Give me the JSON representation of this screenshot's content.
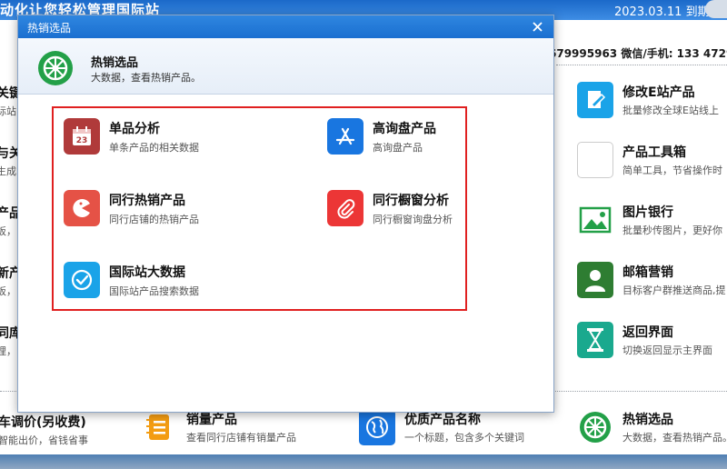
{
  "background": {
    "slogan": "动化让您轻松管理国际站",
    "expiry": "2023.03.11 到期",
    "contact": "679995963  微信/手机: 133 4729",
    "left_items": [
      {
        "title": "关键",
        "desc": "际站"
      },
      {
        "title": "与关",
        "desc": "生成"
      },
      {
        "title": "产品",
        "desc": "板，"
      },
      {
        "title": "新产",
        "desc": "板，"
      },
      {
        "title": "同库",
        "desc": "理，"
      }
    ],
    "right_tools": [
      {
        "title": "修改E站产品",
        "desc": "批量修改全球E站线上"
      },
      {
        "title": "产品工具箱",
        "desc": "简单工具，节省操作时"
      },
      {
        "title": "图片银行",
        "desc": "批量秒传图片，更好你"
      },
      {
        "title": "邮箱营销",
        "desc": "目标客户群推送商品,提"
      },
      {
        "title": "返回界面",
        "desc": "切换返回显示主界面"
      }
    ],
    "bottom_tools": [
      {
        "title": "车调价(另收费)",
        "desc": "智能出价，省钱省事"
      },
      {
        "title": "销量产品",
        "desc": "查看同行店铺有销量产品"
      },
      {
        "title": "优质产品名称",
        "desc": "一个标题，包含多个关键词"
      },
      {
        "title": "热销选品",
        "desc": "大数据，查看热销产品。"
      }
    ]
  },
  "modal": {
    "title": "热销选品",
    "header_title": "热销选品",
    "header_desc": "大数据，查看热销产品。",
    "items": [
      {
        "title": "单品分析",
        "desc": "单条产品的相关数据"
      },
      {
        "title": "高询盘产品",
        "desc": "高询盘产品"
      },
      {
        "title": "同行热销产品",
        "desc": "同行店铺的热销产品"
      },
      {
        "title": "同行橱窗分析",
        "desc": "同行橱窗询盘分析"
      },
      {
        "title": "国际站大数据",
        "desc": "国际站产品搜索数据"
      }
    ]
  },
  "colors": {
    "title_bar": "#1a6fd0",
    "highlight_frame": "#e02020",
    "icon_red_dark": "#b03a3a",
    "icon_blue": "#1976e0",
    "icon_red": "#e55246",
    "icon_red_bright": "#ec3636",
    "icon_cyan": "#1aa3e8",
    "icon_green": "#23a048",
    "icon_teal": "#1aa98e"
  }
}
